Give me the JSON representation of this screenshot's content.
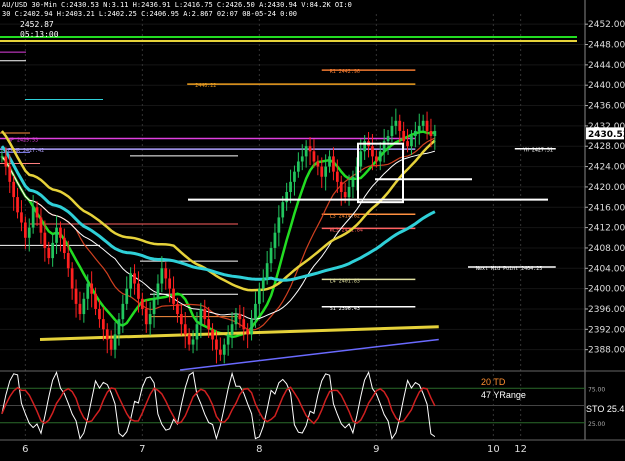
{
  "header": {
    "line1": "AU/USD 30-Min  C:2430.53  N:3.11  H:2436.91  L:2416.75  C:2426.50  A:2430.94  V:84.2K  OI:0",
    "line2": "30  C:2402.94  H:2403.21  L:2402.25  C:2406.95  A:2.867  02:07  08-05-24  0:00",
    "price": "2452.87",
    "time": "05:13:00"
  },
  "colors": {
    "background": "#000000",
    "candle_up": "#22c55e",
    "candle_down": "#ff2020",
    "ma_green": "#22dd22",
    "ma_yellow": "#e6d23a",
    "ma_cyan": "#2fd0d8",
    "ma_white": "#ffffff",
    "ma_red": "#d04020",
    "ma_blue": "#6a6aff",
    "osc_white": "#ffffff",
    "osc_red": "#d02020"
  },
  "chart_data": {
    "type": "candlestick",
    "price_axis": {
      "ylim": [
        2384,
        2454
      ],
      "ticks": [
        "2452.00",
        "2448.00",
        "2444.00",
        "2440.00",
        "2436.00",
        "2432.00",
        "2428.00",
        "2424.00",
        "2420.00",
        "2416.00",
        "2412.00",
        "2408.00",
        "2404.00",
        "2400.00",
        "2396.00",
        "2392.00",
        "2388.00"
      ],
      "current": "2430.53"
    },
    "x_axis": {
      "labels": [
        {
          "text": "6",
          "bar": 6
        },
        {
          "text": "7",
          "bar": 36
        },
        {
          "text": "8",
          "bar": 66
        },
        {
          "text": "9",
          "bar": 96
        },
        {
          "text": "10",
          "bar": 126
        },
        {
          "text": "12",
          "bar": 133
        }
      ],
      "bars_total": 150
    },
    "candles_close": [
      2426,
      2424,
      2421,
      2418,
      2415,
      2413,
      2410,
      2412,
      2416,
      2414,
      2411,
      2408,
      2406,
      2409,
      2412,
      2410,
      2407,
      2404,
      2400,
      2397,
      2395,
      2398,
      2401,
      2399,
      2396,
      2394,
      2392,
      2390,
      2388,
      2391,
      2394,
      2397,
      2400,
      2403,
      2401,
      2398,
      2396,
      2393,
      2395,
      2398,
      2401,
      2404,
      2402,
      2400,
      2397,
      2395,
      2393,
      2391,
      2389,
      2390,
      2393,
      2396,
      2394,
      2392,
      2390,
      2388,
      2387,
      2389,
      2391,
      2393,
      2395,
      2394,
      2392,
      2391,
      2394,
      2397,
      2400,
      2402,
      2405,
      2408,
      2411,
      2414,
      2417,
      2419,
      2421,
      2423,
      2425,
      2426,
      2428,
      2427,
      2425,
      2424,
      2422,
      2424,
      2426,
      2423,
      2421,
      2419,
      2418,
      2420,
      2422,
      2424,
      2427,
      2429,
      2428,
      2426,
      2425,
      2427,
      2429,
      2430,
      2432,
      2433,
      2431,
      2429,
      2428,
      2430,
      2431,
      2432,
      2433,
      2431,
      2430,
      2431
    ],
    "levels": [
      {
        "name": "R1",
        "price": 2442.96,
        "label": "R1  2442.96",
        "color": "#f07a30",
        "x0": 0.55,
        "x1": 0.71
      },
      {
        "name": "R0",
        "price": 2440.22,
        "label": "2440.22",
        "color": "#f0a020",
        "x0": 0.32,
        "x1": 0.71
      },
      {
        "name": "WP",
        "price": 2429.53,
        "label": "WP 2429.53",
        "color": "#e040e0",
        "x0": 0.0,
        "x1": 0.71
      },
      {
        "name": "EQHR",
        "price": 2427.42,
        "label": "EQHR 2427.42",
        "color": "#b0a0ff",
        "x0": 0.0,
        "x1": 0.71
      },
      {
        "name": "YH",
        "price": 2427.51,
        "label": "YH 2427.51",
        "color": "#ffffff",
        "x0": 0.88,
        "x1": 0.95
      },
      {
        "name": "L3",
        "price": 2414.62,
        "label": "L3  2414.62",
        "color": "#ff9040",
        "x0": 0.55,
        "x1": 0.71
      },
      {
        "name": "WL3",
        "price": 2411.84,
        "label": "WL3 2411.84",
        "color": "#ff6060",
        "x0": 0.55,
        "x1": 0.71
      },
      {
        "name": "NextMid",
        "price": 2404.25,
        "label": "Next Mid Point  2404.25",
        "color": "#ffffff",
        "x0": 0.8,
        "x1": 0.95
      },
      {
        "name": "L4",
        "price": 2401.83,
        "label": "L4  2401.83",
        "color": "#e0e0a0",
        "x0": 0.55,
        "x1": 0.71
      },
      {
        "name": "S1",
        "price": 2396.43,
        "label": "S1  2396.43",
        "color": "#ffffff",
        "x0": 0.55,
        "x1": 0.71
      }
    ],
    "oscillator": {
      "labels": [
        "20 TD",
        "47 YRange",
        "STO  25.4"
      ],
      "ticks": [
        "75.00",
        "25.00"
      ],
      "ylim": [
        0,
        100
      ]
    }
  }
}
